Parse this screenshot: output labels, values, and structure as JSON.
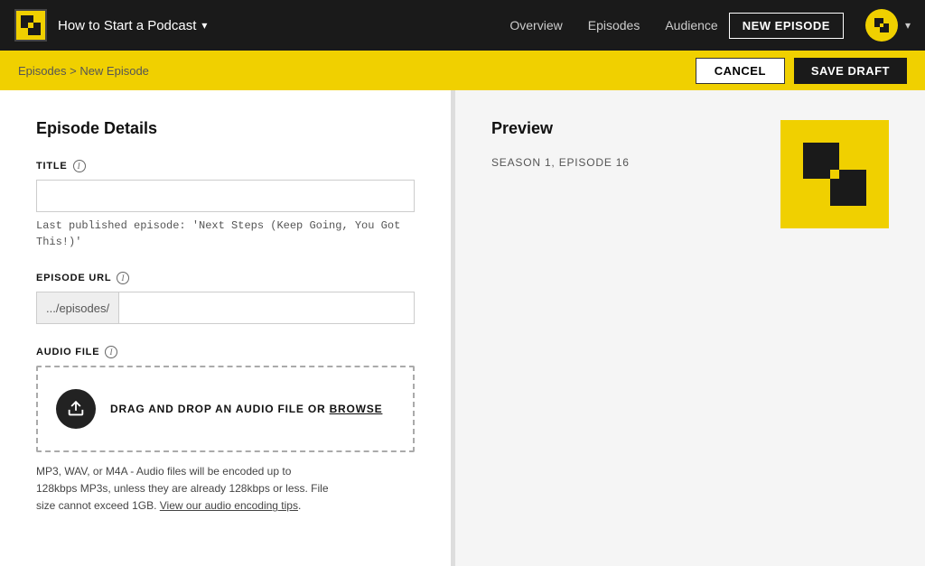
{
  "app": {
    "logo_alt": "Buzzsprout logo",
    "show_name": "How to Start a Podcast",
    "chevron": "▾"
  },
  "nav": {
    "links": [
      {
        "label": "Overview",
        "id": "overview"
      },
      {
        "label": "Episodes",
        "id": "episodes"
      },
      {
        "label": "Audience",
        "id": "audience"
      }
    ],
    "new_episode_button": "NEW EPISODE"
  },
  "breadcrumb": {
    "part1": "Episodes",
    "separator": " > ",
    "part2": "New Episode",
    "cancel_label": "CANCEL",
    "save_draft_label": "SAVE DRAFT"
  },
  "left_panel": {
    "section_title": "Episode Details",
    "title_field": {
      "label": "TITLE",
      "placeholder": "",
      "hint": "Last published episode: 'Next Steps (Keep Going, You Got\nThis!)'"
    },
    "url_field": {
      "label": "EPISODE URL",
      "prefix": ".../episodes/",
      "placeholder": ""
    },
    "audio_field": {
      "label": "AUDIO FILE",
      "drop_text": "DRAG AND DROP AN AUDIO FILE OR ",
      "browse_label": "BROWSE",
      "hint1": "MP3, WAV, or M4A - Audio files will be encoded up to",
      "hint2": "128kbps MP3s, unless they are already 128kbps or less. File",
      "hint3": "size cannot exceed 1GB.",
      "hint_link": "View our audio encoding tips",
      "hint_end": "."
    }
  },
  "right_panel": {
    "section_title": "Preview",
    "episode_meta": "SEASON 1, EPISODE 16"
  }
}
